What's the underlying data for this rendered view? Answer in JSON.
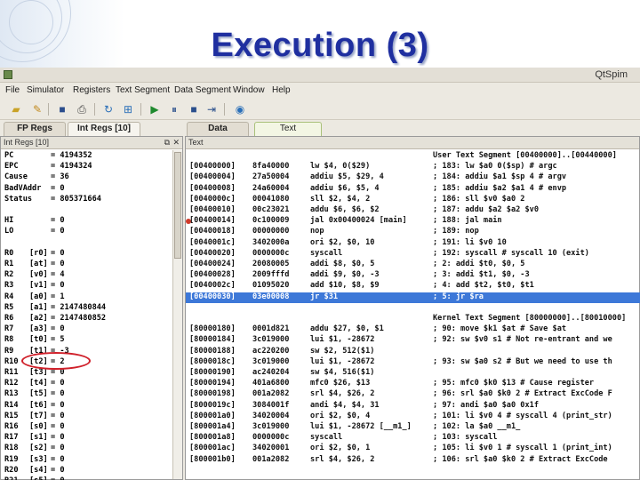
{
  "slide": {
    "title": "Execution (3)"
  },
  "window": {
    "title": "QtSpim"
  },
  "menu": [
    "File",
    "Simulator",
    "Registers",
    "Text Segment",
    "Data Segment",
    "Window",
    "Help"
  ],
  "toolbar": [
    "open-file-icon",
    "reload-icon",
    "save-icon",
    "print-icon",
    "clear-registers-icon",
    "reinitialize-icon",
    "run-icon",
    "pause-icon",
    "stop-icon",
    "single-step-icon",
    "breakpoint-icon",
    "help-icon"
  ],
  "tabs": {
    "fp_regs": "FP Regs",
    "int_regs": "Int Regs [10]",
    "data": "Data",
    "text": "Text"
  },
  "reg_panel": {
    "title": "Int Regs [10]",
    "rows": [
      {
        "name": "PC",
        "alias": "",
        "value": "= 4194352"
      },
      {
        "name": "EPC",
        "alias": "",
        "value": "= 4194324"
      },
      {
        "name": "Cause",
        "alias": "",
        "value": "= 36"
      },
      {
        "name": "BadVAddr",
        "alias": "",
        "value": "= 0"
      },
      {
        "name": "Status",
        "alias": "",
        "value": "= 805371664"
      },
      {
        "name": "",
        "alias": "",
        "value": ""
      },
      {
        "name": "HI",
        "alias": "",
        "value": "= 0"
      },
      {
        "name": "LO",
        "alias": "",
        "value": "= 0"
      },
      {
        "name": "",
        "alias": "",
        "value": ""
      },
      {
        "name": "R0",
        "alias": "[r0]",
        "value": "= 0"
      },
      {
        "name": "R1",
        "alias": "[at]",
        "value": "= 0"
      },
      {
        "name": "R2",
        "alias": "[v0]",
        "value": "= 4"
      },
      {
        "name": "R3",
        "alias": "[v1]",
        "value": "= 0"
      },
      {
        "name": "R4",
        "alias": "[a0]",
        "value": "= 1"
      },
      {
        "name": "R5",
        "alias": "[a1]",
        "value": "= 2147480844"
      },
      {
        "name": "R6",
        "alias": "[a2]",
        "value": "= 2147480852"
      },
      {
        "name": "R7",
        "alias": "[a3]",
        "value": "= 0"
      },
      {
        "name": "R8",
        "alias": "[t0]",
        "value": "= 5"
      },
      {
        "name": "R9",
        "alias": "[t1]",
        "value": "= -3"
      },
      {
        "name": "R10",
        "alias": "[t2]",
        "value": "= 2"
      },
      {
        "name": "R11",
        "alias": "[t3]",
        "value": "= 0"
      },
      {
        "name": "R12",
        "alias": "[t4]",
        "value": "= 0"
      },
      {
        "name": "R13",
        "alias": "[t5]",
        "value": "= 0"
      },
      {
        "name": "R14",
        "alias": "[t6]",
        "value": "= 0"
      },
      {
        "name": "R15",
        "alias": "[t7]",
        "value": "= 0"
      },
      {
        "name": "R16",
        "alias": "[s0]",
        "value": "= 0"
      },
      {
        "name": "R17",
        "alias": "[s1]",
        "value": "= 0"
      },
      {
        "name": "R18",
        "alias": "[s2]",
        "value": "= 0"
      },
      {
        "name": "R19",
        "alias": "[s3]",
        "value": "= 0"
      },
      {
        "name": "R20",
        "alias": "[s4]",
        "value": "= 0"
      },
      {
        "name": "R21",
        "alias": "[s5]",
        "value": "= 0"
      }
    ]
  },
  "text_panel": {
    "title": "Text",
    "lines": [
      {
        "addr": "",
        "hex": "",
        "instr": "",
        "comment": "User Text Segment [00400000]..[00440000]"
      },
      {
        "addr": "[00400000]",
        "hex": "8fa40000",
        "instr": "lw $4, 0($29)",
        "comment": "; 183: lw $a0 0($sp) # argc"
      },
      {
        "addr": "[00400004]",
        "hex": "27a50004",
        "instr": "addiu $5, $29, 4",
        "comment": "; 184: addiu $a1 $sp 4 # argv"
      },
      {
        "addr": "[00400008]",
        "hex": "24a60004",
        "instr": "addiu $6, $5, 4",
        "comment": "; 185: addiu $a2 $a1 4 # envp"
      },
      {
        "addr": "[0040000c]",
        "hex": "00041080",
        "instr": "sll $2, $4, 2",
        "comment": "; 186: sll $v0 $a0 2"
      },
      {
        "addr": "[00400010]",
        "hex": "00c23021",
        "instr": "addu $6, $6, $2",
        "comment": "; 187: addu $a2 $a2 $v0"
      },
      {
        "addr": "[00400014]",
        "hex": "0c100009",
        "instr": "jal 0x00400024 [main]",
        "comment": "; 188: jal main",
        "bp": true
      },
      {
        "addr": "[00400018]",
        "hex": "00000000",
        "instr": "nop",
        "comment": "; 189: nop"
      },
      {
        "addr": "[0040001c]",
        "hex": "3402000a",
        "instr": "ori $2, $0, 10",
        "comment": "; 191: li $v0 10"
      },
      {
        "addr": "[00400020]",
        "hex": "0000000c",
        "instr": "syscall",
        "comment": "; 192: syscall # syscall 10 (exit)"
      },
      {
        "addr": "[00400024]",
        "hex": "20080005",
        "instr": "addi $8, $0, 5",
        "comment": "; 2: addi $t0, $0, 5"
      },
      {
        "addr": "[00400028]",
        "hex": "2009fffd",
        "instr": "addi $9, $0, -3",
        "comment": "; 3: addi $t1, $0, -3"
      },
      {
        "addr": "[0040002c]",
        "hex": "01095020",
        "instr": "add $10, $8, $9",
        "comment": "; 4: add $t2, $t0, $t1"
      },
      {
        "addr": "[00400030]",
        "hex": "03e00008",
        "instr": "jr $31",
        "comment": "; 5: jr $ra",
        "hl": true
      },
      {
        "addr": "",
        "hex": "",
        "instr": "",
        "comment": ""
      },
      {
        "addr": "",
        "hex": "",
        "instr": "",
        "comment": "Kernel Text Segment [80000000]..[80010000]"
      },
      {
        "addr": "[80000180]",
        "hex": "0001d821",
        "instr": "addu $27, $0, $1",
        "comment": "; 90: move $k1 $at # Save $at"
      },
      {
        "addr": "[80000184]",
        "hex": "3c019000",
        "instr": "lui $1, -28672",
        "comment": "; 92: sw $v0 s1 # Not re-entrant and we"
      },
      {
        "addr": "[80000188]",
        "hex": "ac220200",
        "instr": "sw $2, 512($1)",
        "comment": ""
      },
      {
        "addr": "[8000018c]",
        "hex": "3c019000",
        "instr": "lui $1, -28672",
        "comment": "; 93: sw $a0 s2 # But we need to use th"
      },
      {
        "addr": "[80000190]",
        "hex": "ac240204",
        "instr": "sw $4, 516($1)",
        "comment": ""
      },
      {
        "addr": "[80000194]",
        "hex": "401a6800",
        "instr": "mfc0 $26, $13",
        "comment": "; 95: mfc0 $k0 $13 # Cause register"
      },
      {
        "addr": "[80000198]",
        "hex": "001a2082",
        "instr": "srl $4, $26, 2",
        "comment": "; 96: srl $a0 $k0 2 # Extract ExcCode F"
      },
      {
        "addr": "[8000019c]",
        "hex": "3084001f",
        "instr": "andi $4, $4, 31",
        "comment": "; 97: andi $a0 $a0 0x1f"
      },
      {
        "addr": "[800001a0]",
        "hex": "34020004",
        "instr": "ori $2, $0, 4",
        "comment": "; 101: li $v0 4 # syscall 4 (print_str)"
      },
      {
        "addr": "[800001a4]",
        "hex": "3c019000",
        "instr": "lui $1, -28672 [__m1_]",
        "comment": "; 102: la $a0 __m1_"
      },
      {
        "addr": "[800001a8]",
        "hex": "0000000c",
        "instr": "syscall",
        "comment": "; 103: syscall"
      },
      {
        "addr": "[800001ac]",
        "hex": "34020001",
        "instr": "ori $2, $0, 1",
        "comment": "; 105: li $v0 1 # syscall 1 (print_int)"
      },
      {
        "addr": "[800001b0]",
        "hex": "001a2082",
        "instr": "srl $4, $26, 2",
        "comment": "; 106: srl $a0 $k0 2 # Extract ExcCode"
      }
    ]
  }
}
